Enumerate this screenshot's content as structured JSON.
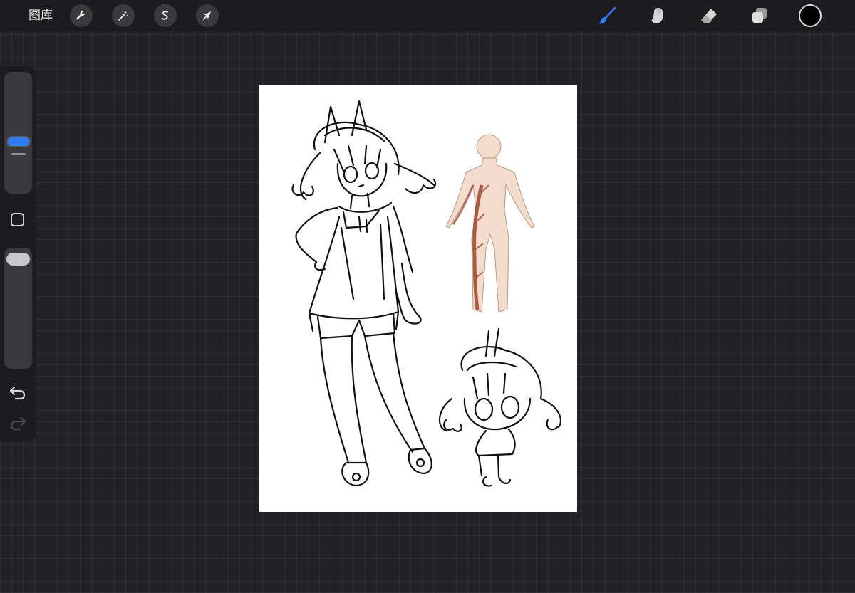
{
  "topbar": {
    "gallery_label": "图库",
    "actions_icon": "wrench-icon",
    "adjustments_icon": "magic-wand-icon",
    "selection_icon": "selection-s-icon",
    "transform_icon": "arrow-cursor-icon",
    "brush_icon": "brush-icon",
    "smudge_icon": "smudge-finger-icon",
    "eraser_icon": "eraser-icon",
    "layers_icon": "layers-icon",
    "current_color": "#000000",
    "active_tool_color": "#2f7df6"
  },
  "sidebar": {
    "brush_size": 0.55,
    "brush_opacity": 1.0,
    "modifier_icon": "square-modifier-icon",
    "undo_icon": "undo-icon",
    "redo_icon": "redo-icon",
    "redo_enabled": false
  },
  "canvas": {
    "background": "#ffffff",
    "skin_color": "#f3dccb",
    "pattern_color": "#a0432e"
  }
}
